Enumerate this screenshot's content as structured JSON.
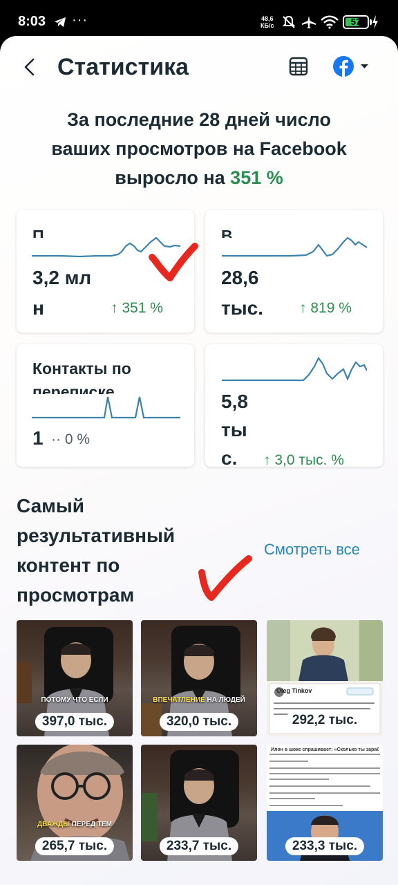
{
  "status_bar": {
    "time": "8:03",
    "dots": "···",
    "speed_value": "48,6",
    "speed_unit": "КБ/с",
    "battery": "57"
  },
  "header": {
    "title": "Статистика"
  },
  "headline": {
    "line1": "За последние 28 дней число",
    "line2": "ваших просмотров на Facebook",
    "line3_prefix": "выросло на ",
    "percent": "351 %"
  },
  "cards": [
    {
      "label": "П",
      "value_line1": "3,2 мл",
      "value_line2": "н",
      "delta": "↑ 351 %"
    },
    {
      "label": "В",
      "value_line1": "28,6",
      "value_line2": "тыс.",
      "delta": "↑ 819 %"
    },
    {
      "label_line1": "Контакты по",
      "label_line2": "переписке",
      "value": "1",
      "delta": "·· 0 %"
    },
    {
      "value_line1": "5,8",
      "value_line2": "ты",
      "value_line3": "с.",
      "delta": "↑ 3,0 тыс. %"
    }
  ],
  "section": {
    "title_lines": [
      "Самый",
      "результативный",
      "контент по",
      "просмотрам"
    ],
    "see_all": "Смотреть все"
  },
  "thumbnails": [
    {
      "views": "397,0 тыс.",
      "caption": "ПОТОМУ ЧТО ЕСЛИ"
    },
    {
      "views": "320,0 тыс.",
      "caption_hl": "ВПЕЧАТЛЕНИЕ",
      "caption": " НА ЛЮДЕЙ"
    },
    {
      "views": "292,2 тыс.",
      "tweet_name": "Oleg Tinkov"
    },
    {
      "views": "265,7 тыс.",
      "caption_hl": "ДВАЖДЫ",
      "caption": " ПЕРЕД ТЕМ"
    },
    {
      "views": "233,7 тыс."
    },
    {
      "views": "233,3 тыс.",
      "text_line": "Илон в шоке спрашивает: «Сколько ты зарабатываешь в неделю?»"
    }
  ],
  "colors": {
    "accent_green": "#2a8c4f",
    "link_blue": "#2a87b8",
    "facebook_blue": "#1877f2",
    "spark_line": "#3b83ad",
    "check_red": "#e8271f"
  }
}
